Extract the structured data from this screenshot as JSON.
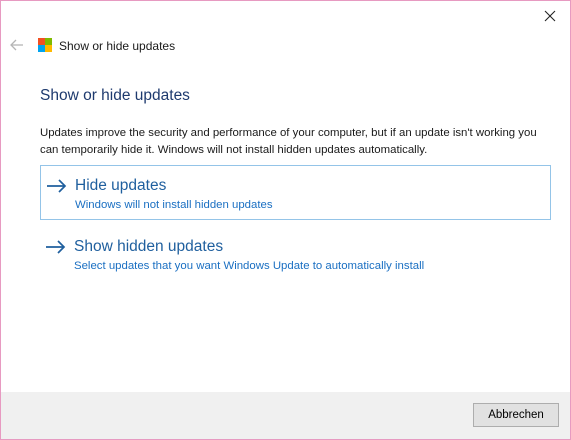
{
  "window": {
    "title": "Show or hide updates"
  },
  "icons": {
    "close": "close-icon",
    "back": "back-arrow-icon",
    "app": "windows-logo-icon",
    "option_arrow": "arrow-right-icon"
  },
  "colors": {
    "accent_link": "#1f5f9e",
    "link_sub": "#1a6fc2",
    "heading": "#1e3a6e",
    "selected_border": "#94c4e8",
    "window_border": "#e79ac1",
    "logo_red": "#f25022",
    "logo_green": "#7fba00",
    "logo_blue": "#00a4ef",
    "logo_yellow": "#ffb900"
  },
  "main": {
    "heading": "Show or hide updates",
    "description": "Updates improve the security and performance of your computer, but if an update isn't working you can temporarily hide it. Windows will not install hidden updates automatically.",
    "options": [
      {
        "title": "Hide updates",
        "subtitle": "Windows will not install hidden updates",
        "selected": true
      },
      {
        "title": "Show hidden updates",
        "subtitle": "Select updates that you want Windows Update to automatically install",
        "selected": false
      }
    ]
  },
  "footer": {
    "cancel_label": "Abbrechen"
  }
}
